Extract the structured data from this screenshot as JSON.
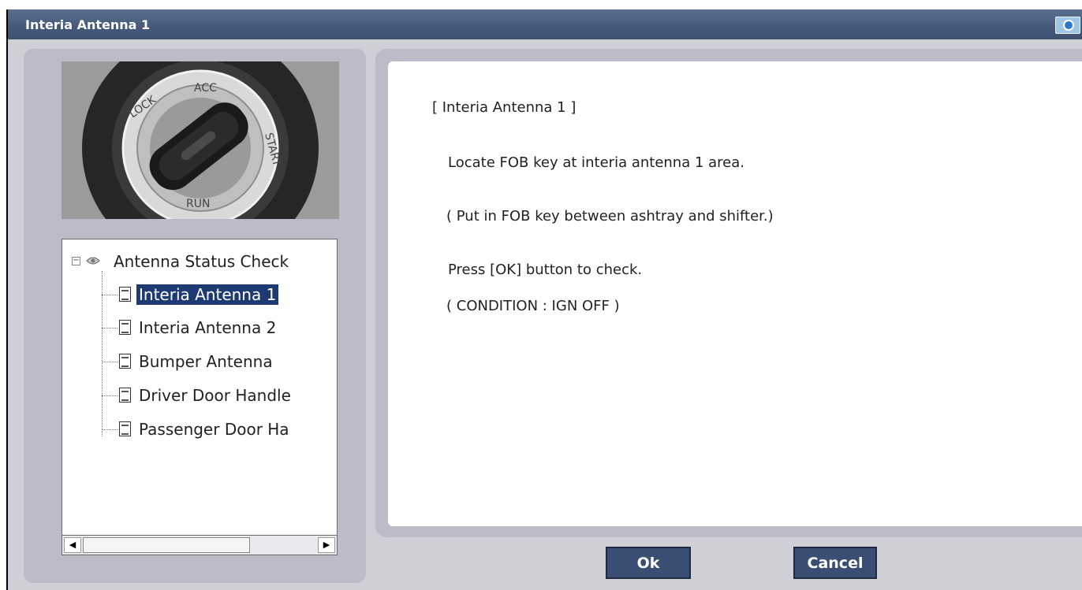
{
  "window": {
    "title": "Interia Antenna 1"
  },
  "photo": {
    "ring_text_left": "LOCK",
    "ring_text_top": "ACC",
    "ring_text_right": "START",
    "ring_text_bottom": "RUN"
  },
  "tree": {
    "root_label": "Antenna Status Check",
    "items": [
      {
        "label": "Interia Antenna 1",
        "selected": true
      },
      {
        "label": "Interia Antenna 2",
        "selected": false
      },
      {
        "label": "Bumper Antenna",
        "selected": false
      },
      {
        "label": "Driver Door Handle",
        "selected": false
      },
      {
        "label": "Passenger Door Ha",
        "selected": false
      }
    ]
  },
  "scrollbar": {
    "left_arrow": "◀",
    "right_arrow": "▶"
  },
  "content": {
    "heading": "[ Interia Antenna 1 ]",
    "line1": "Locate FOB key at interia antenna 1 area.",
    "line2": "( Put in FOB key between ashtray and shifter.)",
    "line3": "Press [OK] button to check.",
    "line4": "( CONDITION : IGN OFF )"
  },
  "buttons": {
    "ok_label": "Ok",
    "cancel_label": "Cancel"
  }
}
